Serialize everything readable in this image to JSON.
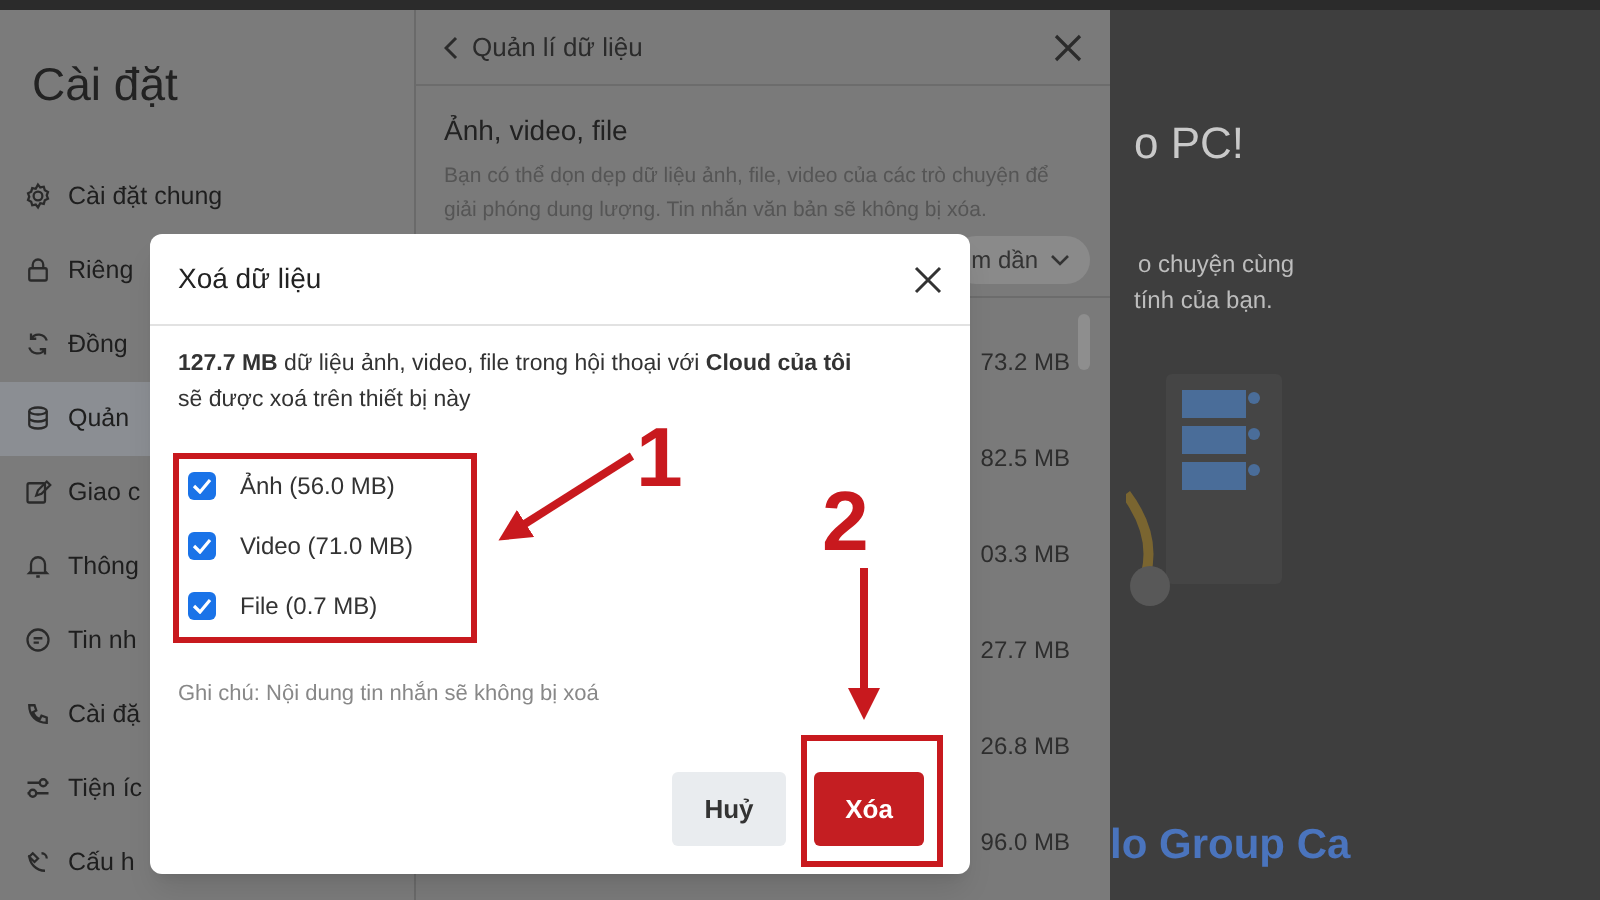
{
  "sidebar": {
    "title": "Cài đặt",
    "items": [
      {
        "label": "Cài đặt chung",
        "selected": false
      },
      {
        "label": "Riêng",
        "selected": false
      },
      {
        "label": "Đồng",
        "selected": false
      },
      {
        "label": "Quản",
        "selected": true
      },
      {
        "label": "Giao c",
        "selected": false
      },
      {
        "label": "Thông",
        "selected": false
      },
      {
        "label": "Tin nh",
        "selected": false
      },
      {
        "label": "Cài đặ",
        "selected": false
      },
      {
        "label": "Tiện íc",
        "selected": false
      },
      {
        "label": "Cấu h",
        "selected": false
      }
    ]
  },
  "data_panel": {
    "back_title": "Quản lí dữ liệu",
    "section_title": "Ảnh, video, file",
    "description": "Bạn có thể dọn dẹp dữ liệu ảnh, file, video của các trò chuyện để giải phóng dung lượng. Tin nhắn văn bản sẽ không bị xóa.",
    "sort_label": "m dần",
    "sizes": [
      "73.2 MB",
      "82.5 MB",
      "03.3 MB",
      "27.7 MB",
      "26.8 MB",
      "96.0 MB"
    ]
  },
  "welcome": {
    "heading": "o PC!",
    "lines": [
      "o chuyện cùng",
      "tính của bạn."
    ],
    "feature_title": "lo Group Ca"
  },
  "dialog": {
    "title": "Xoá dữ liệu",
    "message": "**127.7 MB** dữ liệu ảnh, video, file trong hội thoại với **Cloud của tôi** sẽ được xoá trên thiết bị này",
    "options": [
      {
        "label": "Ảnh (56.0 MB)",
        "checked": true
      },
      {
        "label": "Video (71.0 MB)",
        "checked": true
      },
      {
        "label": "File (0.7 MB)",
        "checked": true
      }
    ],
    "note": "Ghi chú: Nội dung tin nhắn sẽ không bị xoá",
    "buttons": [
      {
        "label": "Huỷ",
        "kind": "secondary"
      },
      {
        "label": "Xóa",
        "kind": "danger"
      }
    ]
  },
  "annotations": [
    {
      "label": "1"
    },
    {
      "label": "2"
    }
  ]
}
